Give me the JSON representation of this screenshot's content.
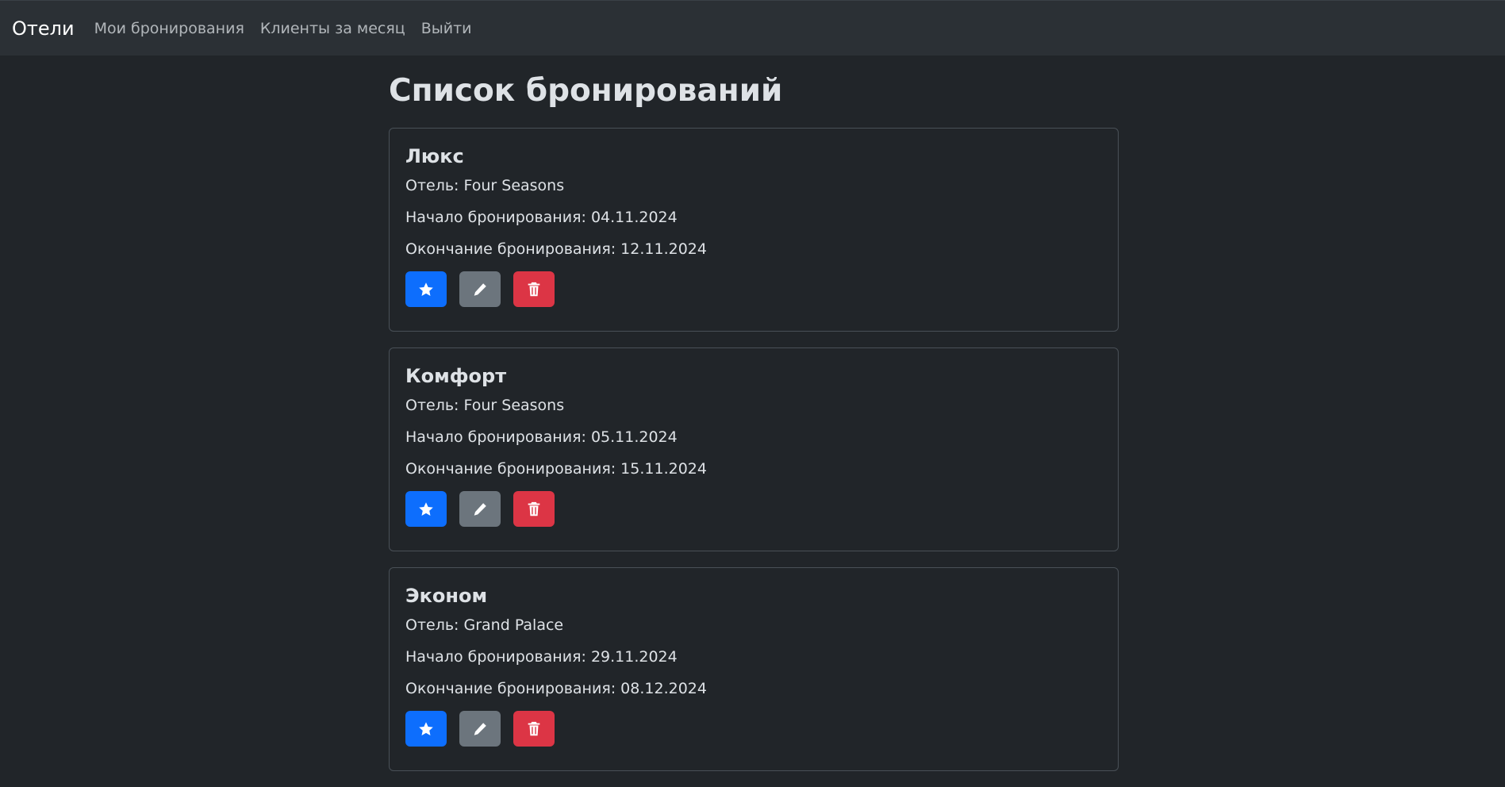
{
  "navbar": {
    "brand": "Отели",
    "links": [
      "Мои бронирования",
      "Клиенты за месяц",
      "Выйти"
    ]
  },
  "page": {
    "title": "Список бронирований"
  },
  "bookings": [
    {
      "room": "Люкс",
      "hotel": "Отель: Four Seasons",
      "start": "Начало бронирования: 04.11.2024",
      "end": "Окончание бронирования: 12.11.2024"
    },
    {
      "room": "Комфорт",
      "hotel": "Отель: Four Seasons",
      "start": "Начало бронирования: 05.11.2024",
      "end": "Окончание бронирования: 15.11.2024"
    },
    {
      "room": "Эконом",
      "hotel": "Отель: Grand Palace",
      "start": "Начало бронирования: 29.11.2024",
      "end": "Окончание бронирования: 08.12.2024"
    }
  ],
  "icons": {
    "favorite": "star-icon",
    "edit": "pencil-icon",
    "delete": "trash-icon"
  },
  "colors": {
    "primary": "#0d6efd",
    "secondary": "#6c757d",
    "danger": "#dc3545",
    "background": "#212529",
    "navbar": "#2b3035"
  }
}
